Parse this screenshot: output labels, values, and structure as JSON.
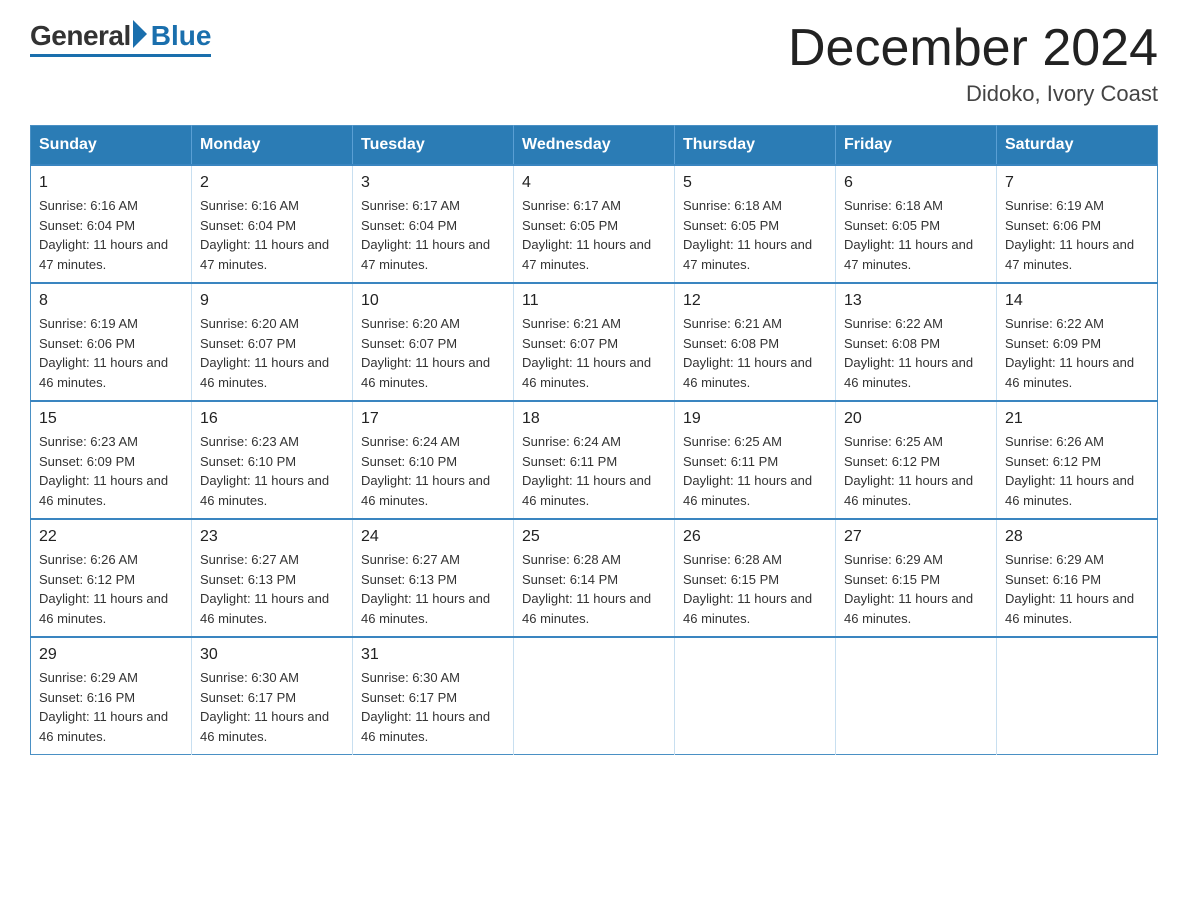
{
  "logo": {
    "general": "General",
    "blue": "Blue"
  },
  "title": "December 2024",
  "subtitle": "Didoko, Ivory Coast",
  "days_of_week": [
    "Sunday",
    "Monday",
    "Tuesday",
    "Wednesday",
    "Thursday",
    "Friday",
    "Saturday"
  ],
  "weeks": [
    [
      {
        "day": "1",
        "sunrise": "6:16 AM",
        "sunset": "6:04 PM",
        "daylight": "11 hours and 47 minutes."
      },
      {
        "day": "2",
        "sunrise": "6:16 AM",
        "sunset": "6:04 PM",
        "daylight": "11 hours and 47 minutes."
      },
      {
        "day": "3",
        "sunrise": "6:17 AM",
        "sunset": "6:04 PM",
        "daylight": "11 hours and 47 minutes."
      },
      {
        "day": "4",
        "sunrise": "6:17 AM",
        "sunset": "6:05 PM",
        "daylight": "11 hours and 47 minutes."
      },
      {
        "day": "5",
        "sunrise": "6:18 AM",
        "sunset": "6:05 PM",
        "daylight": "11 hours and 47 minutes."
      },
      {
        "day": "6",
        "sunrise": "6:18 AM",
        "sunset": "6:05 PM",
        "daylight": "11 hours and 47 minutes."
      },
      {
        "day": "7",
        "sunrise": "6:19 AM",
        "sunset": "6:06 PM",
        "daylight": "11 hours and 47 minutes."
      }
    ],
    [
      {
        "day": "8",
        "sunrise": "6:19 AM",
        "sunset": "6:06 PM",
        "daylight": "11 hours and 46 minutes."
      },
      {
        "day": "9",
        "sunrise": "6:20 AM",
        "sunset": "6:07 PM",
        "daylight": "11 hours and 46 minutes."
      },
      {
        "day": "10",
        "sunrise": "6:20 AM",
        "sunset": "6:07 PM",
        "daylight": "11 hours and 46 minutes."
      },
      {
        "day": "11",
        "sunrise": "6:21 AM",
        "sunset": "6:07 PM",
        "daylight": "11 hours and 46 minutes."
      },
      {
        "day": "12",
        "sunrise": "6:21 AM",
        "sunset": "6:08 PM",
        "daylight": "11 hours and 46 minutes."
      },
      {
        "day": "13",
        "sunrise": "6:22 AM",
        "sunset": "6:08 PM",
        "daylight": "11 hours and 46 minutes."
      },
      {
        "day": "14",
        "sunrise": "6:22 AM",
        "sunset": "6:09 PM",
        "daylight": "11 hours and 46 minutes."
      }
    ],
    [
      {
        "day": "15",
        "sunrise": "6:23 AM",
        "sunset": "6:09 PM",
        "daylight": "11 hours and 46 minutes."
      },
      {
        "day": "16",
        "sunrise": "6:23 AM",
        "sunset": "6:10 PM",
        "daylight": "11 hours and 46 minutes."
      },
      {
        "day": "17",
        "sunrise": "6:24 AM",
        "sunset": "6:10 PM",
        "daylight": "11 hours and 46 minutes."
      },
      {
        "day": "18",
        "sunrise": "6:24 AM",
        "sunset": "6:11 PM",
        "daylight": "11 hours and 46 minutes."
      },
      {
        "day": "19",
        "sunrise": "6:25 AM",
        "sunset": "6:11 PM",
        "daylight": "11 hours and 46 minutes."
      },
      {
        "day": "20",
        "sunrise": "6:25 AM",
        "sunset": "6:12 PM",
        "daylight": "11 hours and 46 minutes."
      },
      {
        "day": "21",
        "sunrise": "6:26 AM",
        "sunset": "6:12 PM",
        "daylight": "11 hours and 46 minutes."
      }
    ],
    [
      {
        "day": "22",
        "sunrise": "6:26 AM",
        "sunset": "6:12 PM",
        "daylight": "11 hours and 46 minutes."
      },
      {
        "day": "23",
        "sunrise": "6:27 AM",
        "sunset": "6:13 PM",
        "daylight": "11 hours and 46 minutes."
      },
      {
        "day": "24",
        "sunrise": "6:27 AM",
        "sunset": "6:13 PM",
        "daylight": "11 hours and 46 minutes."
      },
      {
        "day": "25",
        "sunrise": "6:28 AM",
        "sunset": "6:14 PM",
        "daylight": "11 hours and 46 minutes."
      },
      {
        "day": "26",
        "sunrise": "6:28 AM",
        "sunset": "6:15 PM",
        "daylight": "11 hours and 46 minutes."
      },
      {
        "day": "27",
        "sunrise": "6:29 AM",
        "sunset": "6:15 PM",
        "daylight": "11 hours and 46 minutes."
      },
      {
        "day": "28",
        "sunrise": "6:29 AM",
        "sunset": "6:16 PM",
        "daylight": "11 hours and 46 minutes."
      }
    ],
    [
      {
        "day": "29",
        "sunrise": "6:29 AM",
        "sunset": "6:16 PM",
        "daylight": "11 hours and 46 minutes."
      },
      {
        "day": "30",
        "sunrise": "6:30 AM",
        "sunset": "6:17 PM",
        "daylight": "11 hours and 46 minutes."
      },
      {
        "day": "31",
        "sunrise": "6:30 AM",
        "sunset": "6:17 PM",
        "daylight": "11 hours and 46 minutes."
      },
      null,
      null,
      null,
      null
    ]
  ]
}
